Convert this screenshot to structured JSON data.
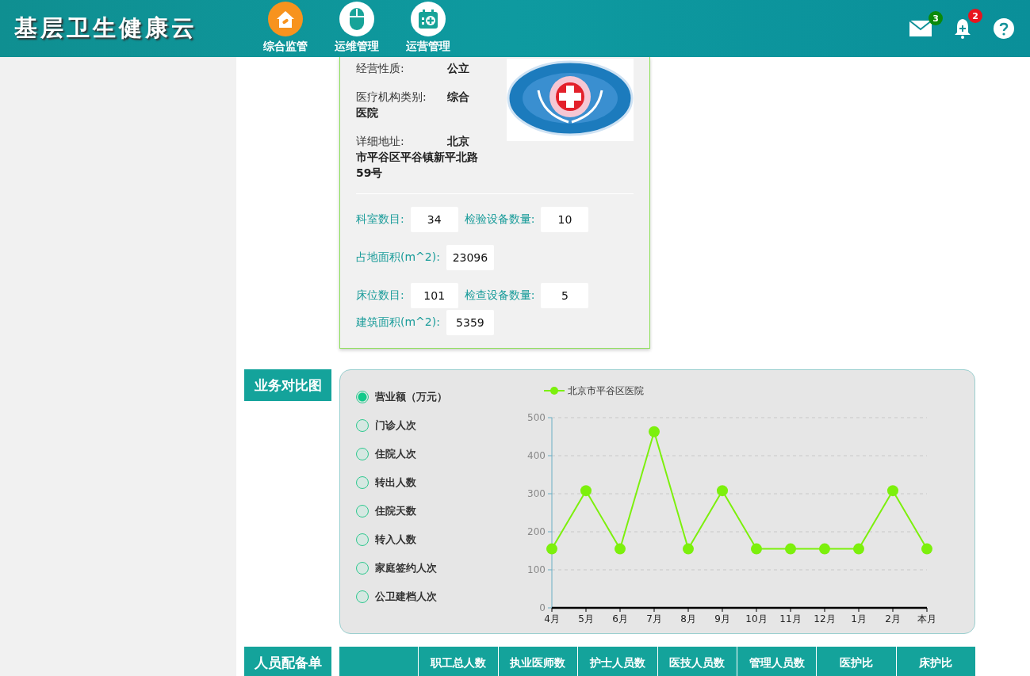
{
  "header": {
    "title": "基层卫生健康云",
    "nav": [
      {
        "label": "综合监管",
        "kind": "home",
        "selected": true
      },
      {
        "label": "运维管理",
        "kind": "mouse",
        "selected": false
      },
      {
        "label": "运营管理",
        "kind": "calendar",
        "selected": false
      }
    ],
    "tools": [
      {
        "kind": "mail",
        "badge": "3",
        "color": "#0a8a0a"
      },
      {
        "kind": "bell",
        "badge": "2",
        "color": "#e8141e"
      },
      {
        "kind": "help"
      }
    ]
  },
  "info": {
    "fields": [
      {
        "label": "经营性质:",
        "value": "公立"
      },
      {
        "label": "医疗机构类别:",
        "value": "综合医院"
      },
      {
        "label": "详细地址:",
        "value": "北京市平谷区平谷镇新平北路59号"
      }
    ],
    "stats": [
      [
        {
          "label": "科室数目:",
          "value": "34"
        },
        {
          "label": "检验设备数量:",
          "value": "10"
        }
      ],
      [
        {
          "label": "占地面积(m^2):",
          "value": "23096"
        }
      ],
      [
        {
          "label": "床位数目:",
          "value": "101"
        },
        {
          "label": "检查设备数量:",
          "value": "5"
        }
      ],
      [
        {
          "label": "建筑面积(m^2):",
          "value": "5359"
        }
      ]
    ]
  },
  "business": {
    "title": "业务对比图",
    "options": [
      {
        "label": "营业额（万元）",
        "selected": true
      },
      {
        "label": "门诊人次",
        "selected": false
      },
      {
        "label": "住院人次",
        "selected": false
      },
      {
        "label": "转出人数",
        "selected": false
      },
      {
        "label": "住院天数",
        "selected": false
      },
      {
        "label": "转入人数",
        "selected": false
      },
      {
        "label": "家庭签约人次",
        "selected": false
      },
      {
        "label": "公卫建档人次",
        "selected": false
      }
    ],
    "chart_data": {
      "type": "line",
      "categories": [
        "4月",
        "5月",
        "6月",
        "7月",
        "8月",
        "9月",
        "10月",
        "11月",
        "12月",
        "1月",
        "2月",
        "本月"
      ],
      "grid": true,
      "series": [
        {
          "name": "北京市平谷区医院",
          "color": "#7cf00c",
          "marker": "circle",
          "values": [
            155,
            308,
            155,
            463,
            155,
            308,
            155,
            155,
            155,
            155,
            308,
            155
          ]
        }
      ],
      "ylim": [
        0,
        500
      ],
      "yticks": [
        0,
        100,
        200,
        300,
        400,
        500
      ]
    }
  },
  "staff": {
    "title": "人员配备单",
    "columns": [
      "职工总人数",
      "执业医师数",
      "护士人员数",
      "医技人员数",
      "管理人员数",
      "医护比",
      "床护比"
    ]
  }
}
